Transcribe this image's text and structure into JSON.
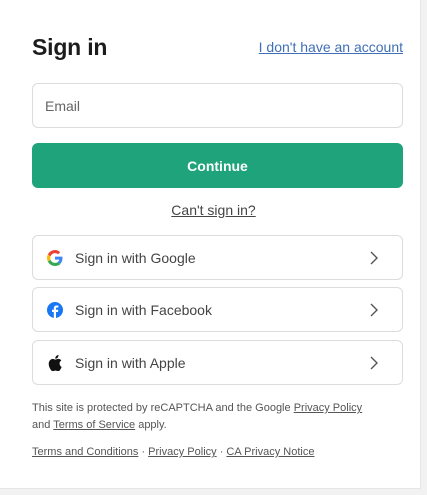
{
  "header": {
    "title": "Sign in",
    "no_account_link": "I don't have an account"
  },
  "email": {
    "placeholder": "Email",
    "value": ""
  },
  "continue_label": "Continue",
  "cant_sign_in": "Can't sign in?",
  "social": [
    {
      "label": "Sign in with Google",
      "icon": "google-icon"
    },
    {
      "label": "Sign in with Facebook",
      "icon": "facebook-icon"
    },
    {
      "label": "Sign in with Apple",
      "icon": "apple-icon"
    }
  ],
  "legal": {
    "prefix": "This site is protected by reCAPTCHA and the Google ",
    "privacy_policy": "Privacy Policy",
    "and": " and ",
    "terms_of_service": "Terms of Service",
    "suffix": " apply."
  },
  "footer": {
    "terms": "Terms and Conditions",
    "sep": " · ",
    "privacy": "Privacy Policy",
    "ca_privacy": "CA Privacy Notice"
  },
  "colors": {
    "accent": "#1fa37a",
    "link": "#3f6fb6",
    "facebook": "#1877f2"
  }
}
